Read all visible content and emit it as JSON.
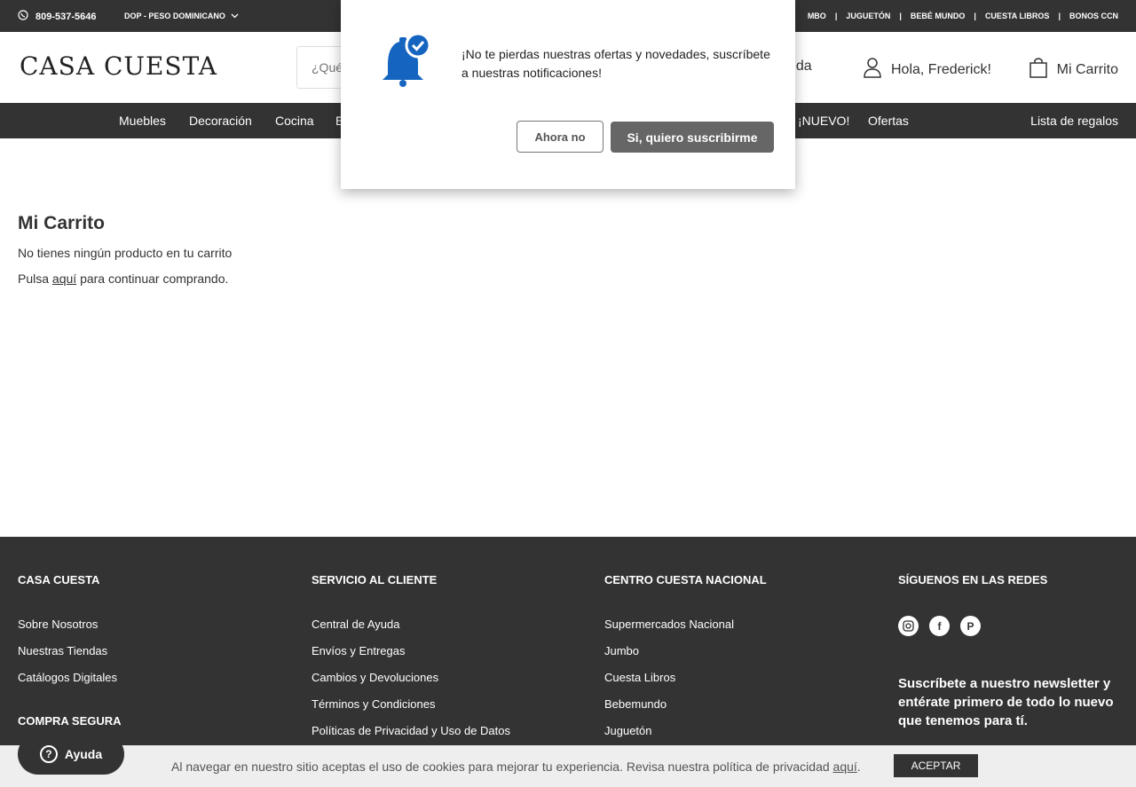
{
  "topbar": {
    "phone": "809-537-5646",
    "currency": "DOP - PESO DOMINICANO",
    "brands": [
      "MBO",
      "JUGUETÓN",
      "BEBÉ MUNDO",
      "CUESTA LIBROS",
      "BONOS CCN"
    ]
  },
  "header": {
    "logo": "CASA CUESTA",
    "search_placeholder": "¿Qué",
    "help": "yuda",
    "user": "Hola, Frederick!",
    "cart": "Mi Carrito"
  },
  "nav": {
    "items": [
      "Muebles",
      "Decoración",
      "Cocina",
      "E",
      "¡NUEVO!",
      "Ofertas"
    ],
    "registry": "Lista de regalos"
  },
  "main": {
    "title": "Mi Carrito",
    "empty": "No tienes ningún producto en tu carrito",
    "continue_pre": "Pulsa",
    "continue_link": "aquí",
    "continue_post": "para continuar comprando."
  },
  "footer": {
    "col1": {
      "heading": "CASA CUESTA",
      "links": [
        "Sobre Nosotros",
        "Nuestras Tiendas",
        "Catálogos Digitales"
      ],
      "subheading": "COMPRA SEGURA"
    },
    "col2": {
      "heading": "SERVICIO AL CLIENTE",
      "links": [
        "Central de Ayuda",
        "Envíos y Entregas",
        "Cambios y Devoluciones",
        "Términos y Condiciones",
        "Políticas de Privacidad y Uso de Datos"
      ]
    },
    "col3": {
      "heading": "CENTRO CUESTA NACIONAL",
      "links": [
        "Supermercados Nacional",
        "Jumbo",
        "Cuesta Libros",
        "Bebemundo",
        "Juguetón"
      ]
    },
    "col4": {
      "heading": "SÍGUENOS EN LAS REDES",
      "social_icons": [
        "instagram-icon",
        "facebook-icon",
        "pinterest-icon"
      ],
      "newsletter": "Suscríbete a nuestro newsletter y entérate primero de todo lo nuevo que tenemos para tí."
    }
  },
  "cookie": {
    "text": "Al navegar en nuestro sitio aceptas el uso de cookies para mejorar tu experiencia. Revisa nuestra política de privacidad",
    "link": "aquí",
    "accept": "ACEPTAR"
  },
  "help_widget": {
    "label": "Ayuda"
  },
  "modal": {
    "message": "¡No te pierdas nuestras ofertas y novedades,  suscríbete a nuestras notificaciones!",
    "no_label": "Ahora no",
    "yes_label": "Si, quiero suscribirme",
    "bell_color": "#1565c0"
  }
}
